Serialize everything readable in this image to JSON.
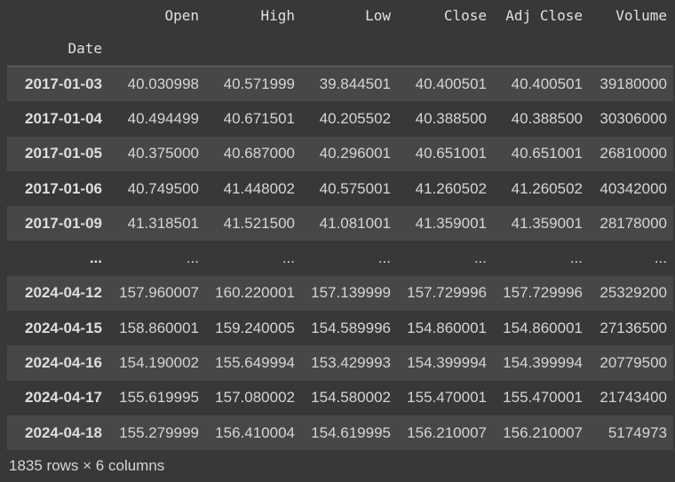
{
  "columns": [
    "Open",
    "High",
    "Low",
    "Close",
    "Adj Close",
    "Volume"
  ],
  "index_name": "Date",
  "rows": [
    {
      "date": "2017-01-03",
      "values": [
        "40.030998",
        "40.571999",
        "39.844501",
        "40.400501",
        "40.400501",
        "39180000"
      ]
    },
    {
      "date": "2017-01-04",
      "values": [
        "40.494499",
        "40.671501",
        "40.205502",
        "40.388500",
        "40.388500",
        "30306000"
      ]
    },
    {
      "date": "2017-01-05",
      "values": [
        "40.375000",
        "40.687000",
        "40.296001",
        "40.651001",
        "40.651001",
        "26810000"
      ]
    },
    {
      "date": "2017-01-06",
      "values": [
        "40.749500",
        "41.448002",
        "40.575001",
        "41.260502",
        "41.260502",
        "40342000"
      ]
    },
    {
      "date": "2017-01-09",
      "values": [
        "41.318501",
        "41.521500",
        "41.081001",
        "41.359001",
        "41.359001",
        "28178000"
      ]
    },
    {
      "date": "...",
      "values": [
        "...",
        "...",
        "...",
        "...",
        "...",
        "..."
      ]
    },
    {
      "date": "2024-04-12",
      "values": [
        "157.960007",
        "160.220001",
        "157.139999",
        "157.729996",
        "157.729996",
        "25329200"
      ]
    },
    {
      "date": "2024-04-15",
      "values": [
        "158.860001",
        "159.240005",
        "154.589996",
        "154.860001",
        "154.860001",
        "27136500"
      ]
    },
    {
      "date": "2024-04-16",
      "values": [
        "154.190002",
        "155.649994",
        "153.429993",
        "154.399994",
        "154.399994",
        "20779500"
      ]
    },
    {
      "date": "2024-04-17",
      "values": [
        "155.619995",
        "157.080002",
        "154.580002",
        "155.470001",
        "155.470001",
        "21743400"
      ]
    },
    {
      "date": "2024-04-18",
      "values": [
        "155.279999",
        "156.410004",
        "154.619995",
        "156.210007",
        "156.210007",
        "5174973"
      ]
    }
  ],
  "footer": "1835 rows × 6 columns",
  "colors": {
    "background": "#383838",
    "row_stripe": "#474747",
    "text": "#d5d5d5"
  }
}
